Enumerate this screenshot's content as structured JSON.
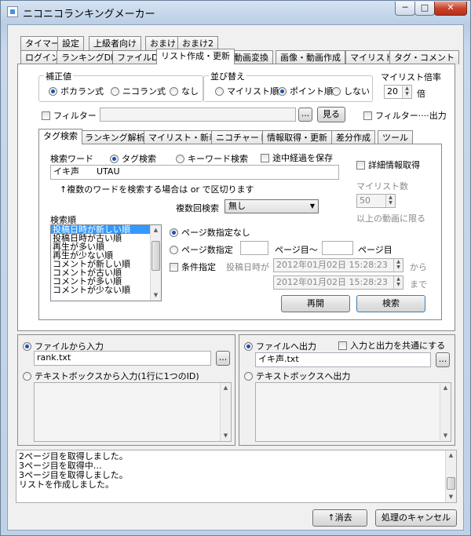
{
  "window": {
    "title": "ニコニコランキングメーカー",
    "min": "─",
    "max": "□",
    "close": "✕"
  },
  "tabs_row1": [
    "タイマー",
    "設定",
    "上級者向け",
    "おまけ",
    "おまけ2"
  ],
  "tabs_row2": [
    "ログイン",
    "ランキングDL",
    "ファイルDL",
    "リスト作成・更新",
    "動画変換",
    "画像・動画作成",
    "マイリスト",
    "タグ・コメント"
  ],
  "correction": {
    "label": "補正値",
    "options": [
      "ボカラン式",
      "ニコラン式",
      "なし"
    ],
    "selected": 0
  },
  "sort": {
    "label": "並び替え",
    "options": [
      "マイリスト順",
      "ポイント順",
      "しない"
    ],
    "selected": 1
  },
  "mylist_ratio": {
    "label": "マイリスト倍率",
    "value": "20",
    "unit": "倍"
  },
  "filter": {
    "label": "フィルター",
    "browse": "...",
    "view": "見る",
    "output_label": "フィルター····出力"
  },
  "subtabs": [
    "タグ検索",
    "ランキング解析",
    "マイリスト・新着",
    "ニコチャート",
    "情報取得・更新",
    "差分作成",
    "ツール"
  ],
  "search": {
    "word_label": "検索ワード",
    "mode_options": [
      "タグ検索",
      "キーワード検索"
    ],
    "mode_selected": 0,
    "save_progress": "途中経過を保存",
    "word_value": "イキ声　　UTAU",
    "hint": "↑複数のワードを検索する場合は or で区切ります",
    "detail": "詳細情報取得",
    "mylist_count_label": "マイリスト数",
    "mylist_count": "50",
    "mylist_count_suffix": "以上の動画に限る",
    "multi_label": "複数回検索",
    "multi_value": "無し",
    "order_label": "検索順",
    "order_items": [
      "投稿日時が新しい順",
      "投稿日時が古い順",
      "再生が多い順",
      "再生が少ない順",
      "コメントが新しい順",
      "コメントが古い順",
      "コメントが多い順",
      "コメントが少ない順"
    ],
    "page_none": "ページ数指定なし",
    "page_spec": "ページ数指定",
    "page_from_suffix": "ページ目～",
    "page_to_suffix": "ページ目",
    "cond": "条件指定",
    "posted_label": "投稿日時が",
    "date_from": "2012年01月02日 15:28:23",
    "date_to": "2012年01月02日 15:28:23",
    "from_suffix": "から",
    "to_suffix": "まで",
    "resume": "再開",
    "search_btn": "検索"
  },
  "input_panel": {
    "file_label": "ファイルから入力",
    "file_value": "rank.txt",
    "browse": "...",
    "textbox_label": "テキストボックスから入力(1行に1つのID)"
  },
  "output_panel": {
    "file_label": "ファイルへ出力",
    "common_label": "入力と出力を共通にする",
    "file_value": "イキ声.txt",
    "browse": "...",
    "textbox_label": "テキストボックスへ出力"
  },
  "log": [
    "2ページ目を取得しました。",
    "3ページ目を取得中…",
    "3ページ目を取得しました。",
    "リストを作成しました。"
  ],
  "bottom": {
    "clear": "↑消去",
    "cancel": "処理のキャンセル"
  }
}
